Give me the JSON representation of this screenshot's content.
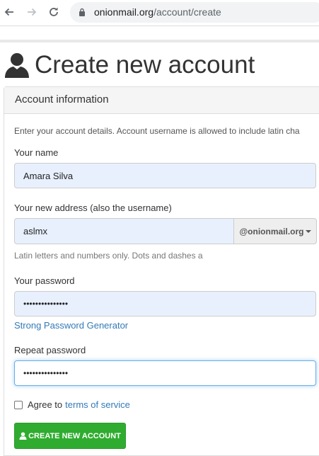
{
  "browser": {
    "url_domain": "onionmail.org",
    "url_path": "/account/create"
  },
  "page": {
    "title": "Create new account"
  },
  "panel": {
    "heading": "Account information",
    "intro": "Enter your account details. Account username is allowed to include latin cha"
  },
  "form": {
    "name_label": "Your name",
    "name_value": "Amara Silva",
    "address_label": "Your new address (also the username)",
    "address_value": "aslmx",
    "domain_option": "@onionmail.org",
    "address_help": "Latin letters and numbers only. Dots and dashes a",
    "password_label": "Your password",
    "password_value": "•••••••••••••••",
    "password_generator_link": "Strong Password Generator",
    "repeat_label": "Repeat password",
    "repeat_value": "•••••••••••••••",
    "agree_text": "Agree to",
    "tos_link": "terms of service",
    "submit_label": "CREATE NEW ACCOUNT"
  },
  "colors": {
    "link": "#337ab7",
    "submit_bg": "#2fac2f",
    "autofill_bg": "#e8f0fe",
    "focus_border": "#66afe9"
  },
  "icons": {
    "back": "arrow-left-icon",
    "forward": "arrow-right-icon",
    "reload": "reload-icon",
    "lock": "lock-icon",
    "user": "user-icon"
  }
}
